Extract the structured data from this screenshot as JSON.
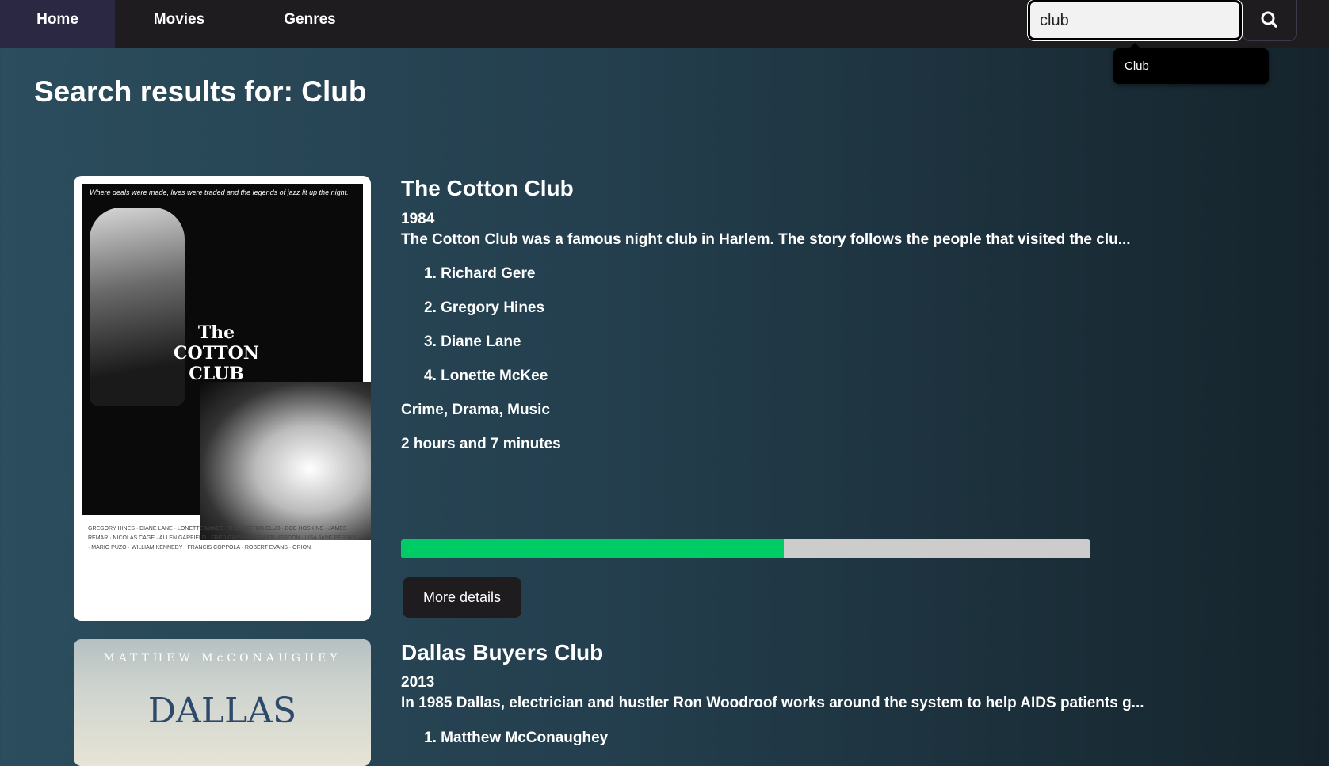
{
  "nav": {
    "items": [
      {
        "label": "Home"
      },
      {
        "label": "Movies"
      },
      {
        "label": "Genres"
      }
    ]
  },
  "search": {
    "value": "club",
    "icon": "search-icon",
    "suggestion": "Club"
  },
  "page": {
    "title": "Search results for: Club"
  },
  "movies": [
    {
      "title": "The Cotton Club",
      "year": "1984",
      "description": "The Cotton Club was a famous night club in Harlem. The story follows the people that visited the clu...",
      "cast": [
        "1. Richard Gere",
        "2. Gregory Hines",
        "3. Diane Lane",
        "4. Lonette McKee"
      ],
      "genres": "Crime, Drama, Music",
      "runtime": "2 hours and 7 minutes",
      "rating_fraction": 0.555,
      "more_label": "More details",
      "poster": {
        "tagline": "Where deals were made, lives were traded and the legends of jazz lit up the night.",
        "logo": "The COTTON CLUB",
        "credits": "GREGORY HINES · DIANE LANE · LONETTE McKEE · THE COTTON CLUB · BOB HOSKINS · JAMES REMAR · NICOLAS CAGE · ALLEN GARFIELD · FRED GWYNNE · GWEN VERDON · LISA JANE PERSKY · MARIO PUZO · WILLIAM KENNEDY · FRANCIS COPPOLA · ROBERT EVANS · ORION"
      }
    },
    {
      "title": "Dallas Buyers Club",
      "year": "2013",
      "description": "In 1985 Dallas, electrician and hustler Ron Woodroof works around the system to help AIDS patients g...",
      "cast": [
        "1. Matthew McConaughey"
      ],
      "poster": {
        "actor": "MATTHEW McCONAUGHEY",
        "title": "DALLAS"
      }
    }
  ],
  "colors": {
    "navbar": "#1f1c20",
    "nav_active": "#2a2842",
    "progress_fill": "#00cc66",
    "progress_track": "#cccccc"
  }
}
